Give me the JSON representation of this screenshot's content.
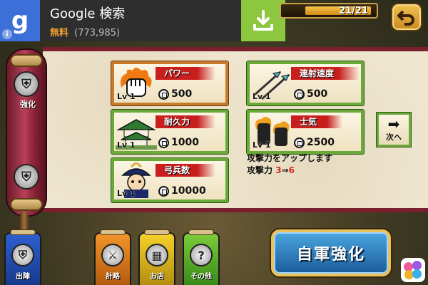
{
  "ad": {
    "logo": "g",
    "info": "i",
    "title": "Google 検索",
    "price": "無料",
    "rating_count": "(773,985)",
    "download_icon": "download-icon"
  },
  "hud": {
    "stamina": "21/21",
    "stamina_fraction": 1.0,
    "back_icon": "back-arrow-icon"
  },
  "sidebar": {
    "items": [
      {
        "label": "強化",
        "icon": "helmet-icon"
      },
      {
        "label": "",
        "icon": "helmet-icon"
      }
    ]
  },
  "upgrades": [
    {
      "name": "パワー",
      "level": "Lv 1",
      "cost": "500",
      "icon": "fist-icon",
      "selected": true
    },
    {
      "name": "連射速度",
      "level": "Lv 1",
      "cost": "500",
      "icon": "arrows-icon",
      "selected": false
    },
    {
      "name": "耐久力",
      "level": "Lv 1",
      "cost": "1000",
      "icon": "castle-icon",
      "selected": false
    },
    {
      "name": "士気",
      "level": "Lv 1",
      "cost": "2500",
      "icon": "fists-icon",
      "selected": false
    },
    {
      "name": "弓兵数",
      "level": "Lv 1",
      "cost": "10000",
      "icon": "archer-icon",
      "selected": false
    }
  ],
  "description": {
    "line1": "攻撃力をアップします",
    "line2_prefix": "攻撃力 ",
    "from": "3",
    "arrow": "⇒",
    "to": "6"
  },
  "next_button": {
    "label": "次へ",
    "icon": "right-arrow-icon"
  },
  "bottom_menu": [
    {
      "label": "出陣",
      "icon": "helmet-icon",
      "color": "#2e5fd0"
    },
    {
      "label": "計略",
      "icon": "crossed-swords-icon",
      "color": "#f2952a"
    },
    {
      "label": "お店",
      "icon": "shop-icon",
      "color": "#f4d12a"
    },
    {
      "label": "その他",
      "icon": "question-icon",
      "color": "#7ccc3a"
    }
  ],
  "main_button": {
    "label": "自軍強化"
  },
  "colors": {
    "card_border": "#6aa83a",
    "selected_border": "#c77a2a",
    "ribbon": "#c81e1e",
    "main_button": "#2a7cc0"
  }
}
